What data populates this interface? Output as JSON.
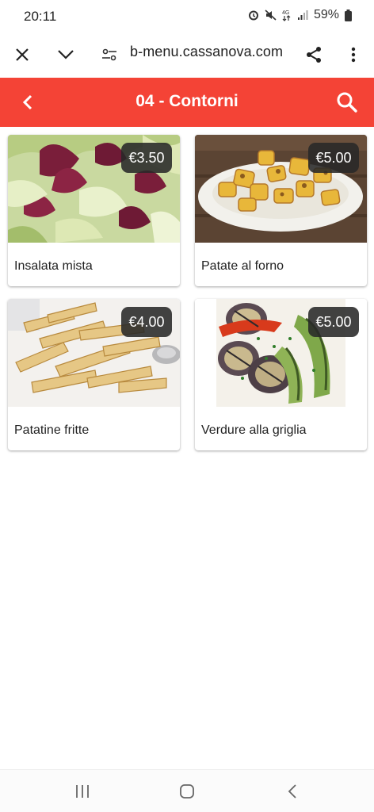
{
  "status": {
    "time": "20:11",
    "battery": "59%"
  },
  "browser": {
    "url": "b-menu.cassanova.com"
  },
  "header": {
    "title": "04 - Contorni"
  },
  "items": [
    {
      "name": "Insalata mista",
      "price": "€3.50"
    },
    {
      "name": "Patate al forno",
      "price": "€5.00"
    },
    {
      "name": "Patatine fritte",
      "price": "€4.00"
    },
    {
      "name": "Verdure alla griglia",
      "price": "€5.00"
    }
  ],
  "colors": {
    "accent": "#f44336",
    "badge": "#2e2e2e"
  }
}
